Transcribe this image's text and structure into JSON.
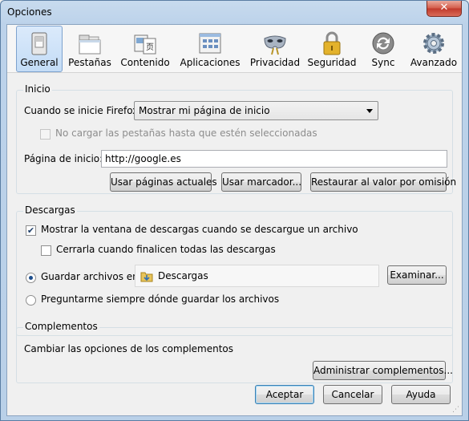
{
  "window": {
    "title": "Opciones",
    "close_glyph": "✕"
  },
  "toolbar": {
    "panes": [
      {
        "label": "General",
        "icon": "switch-icon",
        "selected": true
      },
      {
        "label": "Pestañas",
        "icon": "tabs-icon"
      },
      {
        "label": "Contenido",
        "icon": "content-icon"
      },
      {
        "label": "Aplicaciones",
        "icon": "applications-icon"
      },
      {
        "label": "Privacidad",
        "icon": "mask-icon"
      },
      {
        "label": "Seguridad",
        "icon": "padlock-icon"
      },
      {
        "label": "Sync",
        "icon": "sync-icon"
      },
      {
        "label": "Avanzado",
        "icon": "gear-icon"
      }
    ]
  },
  "startup": {
    "title": "Inicio",
    "when_starts_label": "Cuando se inicie Firefox:",
    "when_starts_value": "Mostrar mi página de inicio",
    "dont_load_tabs_label": "No cargar las pestañas hasta que estén seleccionadas",
    "dont_load_tabs_checked": false,
    "homepage_label": "Página de inicio:",
    "homepage_value": "http://google.es",
    "use_current_pages": "Usar páginas actuales",
    "use_bookmark": "Usar marcador...",
    "restore_default": "Restaurar al valor por omisión"
  },
  "downloads": {
    "title": "Descargas",
    "show_window_label": "Mostrar la ventana de descargas cuando se descargue un archivo",
    "show_window_checked": true,
    "close_when_done_label": "Cerrarla cuando finalicen todas las descargas",
    "close_when_done_checked": false,
    "save_to_label": "Guardar archivos en",
    "save_to_folder": "Descargas",
    "save_to_selected": true,
    "browse": "Examinar...",
    "always_ask_label": "Preguntarme siempre dónde guardar los archivos"
  },
  "addons": {
    "title": "Complementos",
    "description": "Cambiar las opciones de los complementos",
    "manage": "Administrar complementos..."
  },
  "footer": {
    "accept": "Aceptar",
    "cancel": "Cancelar",
    "help": "Ayuda"
  },
  "colors": {
    "selected_pane": "#c3dcf6",
    "title_bar": "#bcd2ea",
    "close_button": "#c0392b"
  }
}
